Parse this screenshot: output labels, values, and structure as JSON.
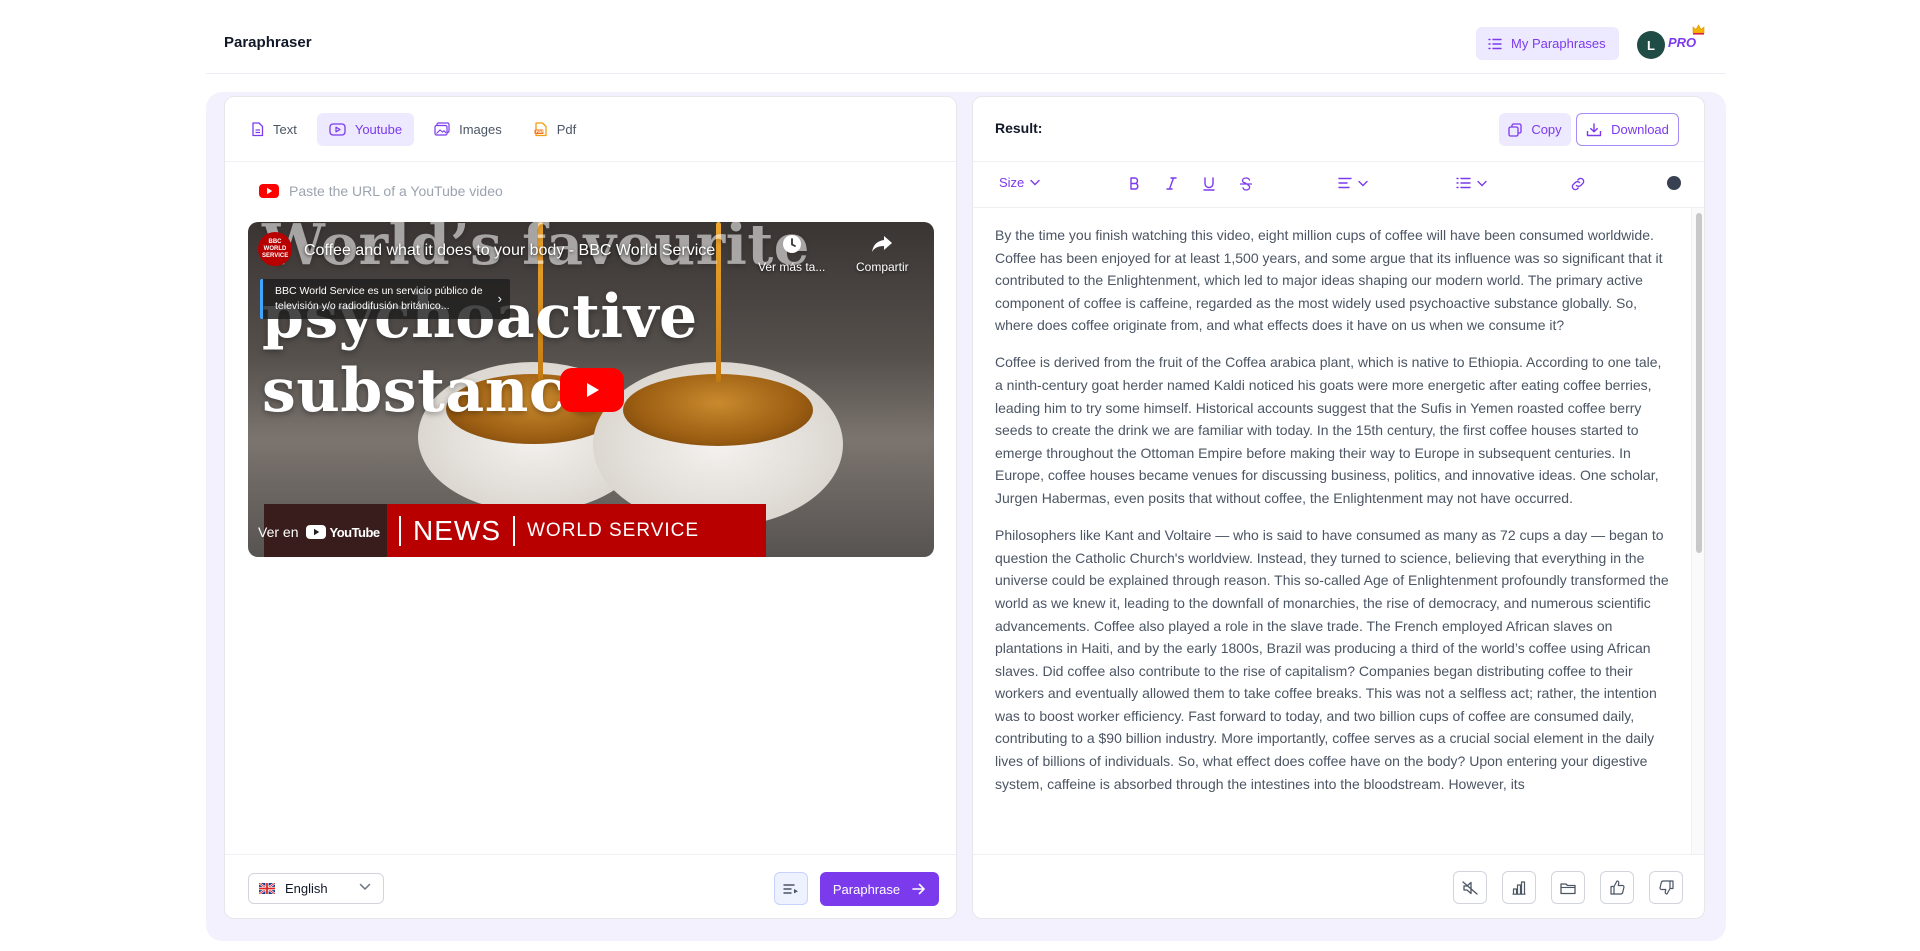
{
  "header": {
    "app_title": "Paraphraser",
    "my_paraphrases_label": "My Paraphrases",
    "avatar_initial": "L",
    "plan_badge": "PRO"
  },
  "tabs": [
    {
      "label": "Text",
      "icon": "file-text-icon",
      "active": false
    },
    {
      "label": "Youtube",
      "icon": "youtube-icon",
      "active": true
    },
    {
      "label": "Images",
      "icon": "image-icon",
      "active": false
    },
    {
      "label": "Pdf",
      "icon": "pdf-icon",
      "active": false
    }
  ],
  "url_input": {
    "placeholder": "Paste the URL of a YouTube video",
    "value": ""
  },
  "video": {
    "channel_logo_text": "BBC WORLD SERVICE",
    "title": "Coffee and what it does to your body - BBC World Service",
    "watch_later_label": "Ver más ta...",
    "share_label": "Compartir",
    "notice_text": "BBC World Service es un servicio público de televisión y/o radiodifusión británico...",
    "overlay_line1": "World’s favourite",
    "overlay_line2": "psychoactive",
    "overlay_line3": "substance",
    "watch_on_label": "Ver en",
    "youtube_label": "YouTube",
    "news_label": "NEWS",
    "world_service_label": "WORLD SERVICE"
  },
  "left_footer": {
    "language": "English",
    "paraphrase_label": "Paraphrase"
  },
  "result": {
    "title": "Result:",
    "copy_label": "Copy",
    "download_label": "Download",
    "toolbar": {
      "size_label": "Size"
    },
    "paragraphs": [
      "By the time you finish watching this video, eight million cups of coffee will have been consumed worldwide. Coffee has been enjoyed for at least 1,500 years, and some argue that its influence was so significant that it contributed to the Enlightenment, which led to major ideas shaping our modern world. The primary active component of coffee is caffeine, regarded as the most widely used psychoactive substance globally. So, where does coffee originate from, and what effects does it have on us when we consume it?",
      "Coffee is derived from the fruit of the Coffea arabica plant, which is native to Ethiopia. According to one tale, a ninth-century goat herder named Kaldi noticed his goats were more energetic after eating coffee berries, leading him to try some himself. Historical accounts suggest that the Sufis in Yemen roasted coffee berry seeds to create the drink we are familiar with today. In the 15th century, the first coffee houses started to emerge throughout the Ottoman Empire before making their way to Europe in subsequent centuries. In Europe, coffee houses became venues for discussing business, politics, and innovative ideas. One scholar, Jurgen Habermas, even posits that without coffee, the Enlightenment may not have occurred.",
      "Philosophers like Kant and Voltaire — who is said to have consumed as many as 72 cups a day — began to question the Catholic Church's worldview. Instead, they turned to science, believing that everything in the universe could be explained through reason. This so-called Age of Enlightenment profoundly transformed the world as we knew it, leading to the downfall of monarchies, the rise of democracy, and numerous scientific advancements. Coffee also played a role in the slave trade. The French employed African slaves on plantations in Haiti, and by the early 1800s, Brazil was producing a third of the world’s coffee using African slaves. Did coffee also contribute to the rise of capitalism? Companies began distributing coffee to their workers and eventually allowed them to take coffee breaks. This was not a selfless act; rather, the intention was to boost worker efficiency. Fast forward to today, and two billion cups of coffee are consumed daily, contributing to a $90 billion industry. More importantly, coffee serves as a crucial social element in the daily lives of billions of individuals. So, what effect does coffee have on the body? Upon entering your digestive system, caffeine is absorbed through the intestines into the bloodstream. However, its"
    ]
  },
  "colors": {
    "accent": "#7c3aed",
    "accent_light": "#ede9fe",
    "workspace_bg": "#f3f1fe",
    "youtube_red": "#ff0000",
    "bbc_red": "#b80000"
  }
}
